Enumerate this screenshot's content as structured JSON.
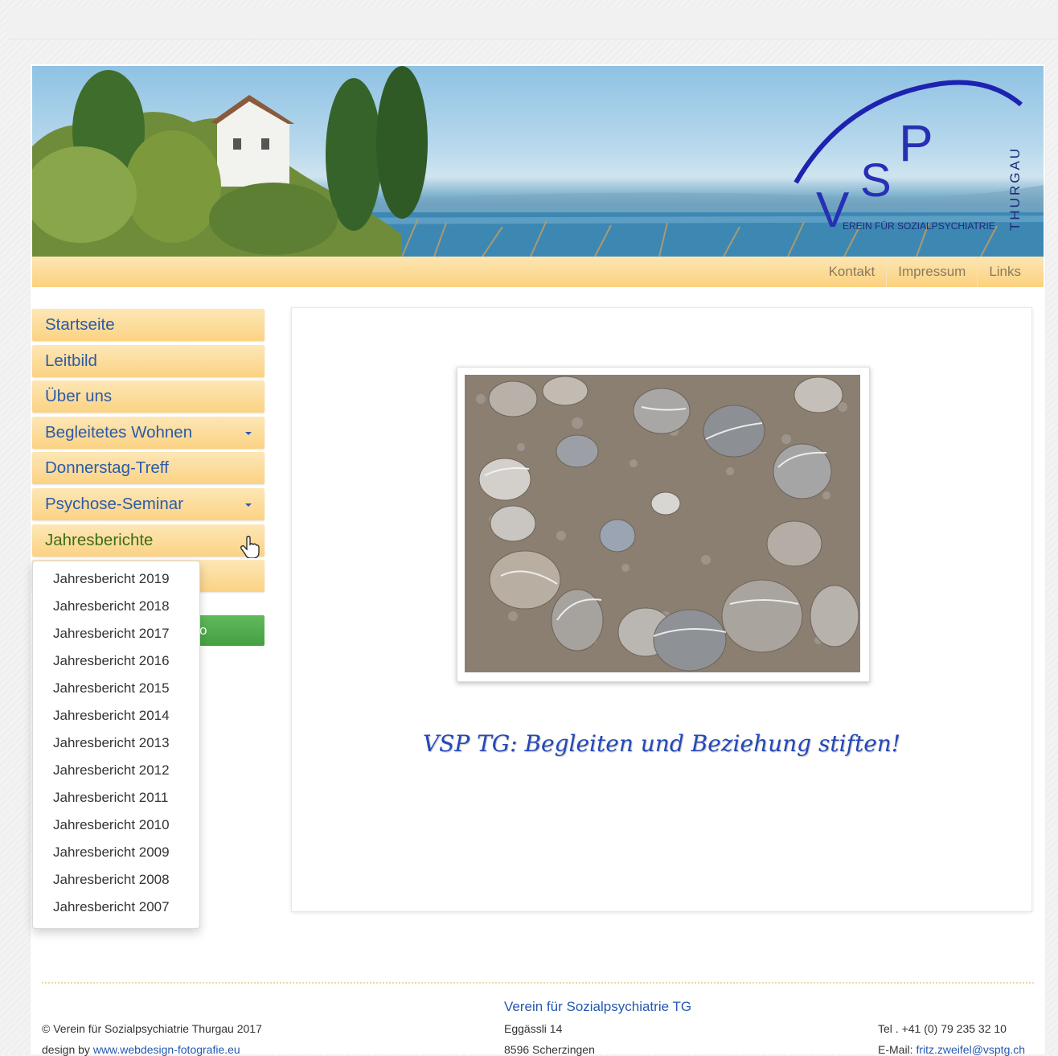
{
  "logo": {
    "brand": "VSP",
    "region": "THURGAU",
    "tagline": "VEREIN FÜR SOZIALPSYCHIATRIE"
  },
  "topnav": [
    {
      "label": "Kontakt"
    },
    {
      "label": "Impressum"
    },
    {
      "label": "Links"
    }
  ],
  "menu": [
    {
      "label": "Startseite"
    },
    {
      "label": "Leitbild"
    },
    {
      "label": "Über uns"
    },
    {
      "label": "Begleitetes Wohnen",
      "has_submenu": true
    },
    {
      "label": "Donnerstag-Treff"
    },
    {
      "label": "Psychose-Seminar",
      "has_submenu": true
    },
    {
      "label": "Jahresberichte",
      "active": true
    }
  ],
  "green_button_fragment": "o",
  "dropdown": [
    "Jahresbericht 2019",
    "Jahresbericht 2018",
    "Jahresbericht 2017",
    "Jahresbericht 2016",
    "Jahresbericht 2015",
    "Jahresbericht 2014",
    "Jahresbericht 2013",
    "Jahresbericht 2012",
    "Jahresbericht 2011",
    "Jahresbericht 2010",
    "Jahresbericht 2009",
    "Jahresbericht 2008",
    "Jahresbericht 2007"
  ],
  "slogan": "VSP TG: Begleiten und Beziehung stiften!",
  "footer": {
    "copyright": "© Verein für Sozialpsychiatrie Thurgau 2017",
    "design_prefix": "design by",
    "design_link": "www.webdesign-fotografie.eu",
    "org_name": "Verein für Sozialpsychiatrie TG",
    "street": "Eggässli 14",
    "city": "8596 Scherzingen",
    "tel": "Tel . +41 (0) 79 235 32 10",
    "email_prefix": "E-Mail:",
    "email": "fritz.zweifel@vsptg.ch"
  },
  "colors": {
    "menu_text": "#2c5aa8",
    "menu_active": "#3b6e18",
    "menu_bg": "#fbd283",
    "slogan": "#2448b8",
    "green": "#4ea64a"
  }
}
